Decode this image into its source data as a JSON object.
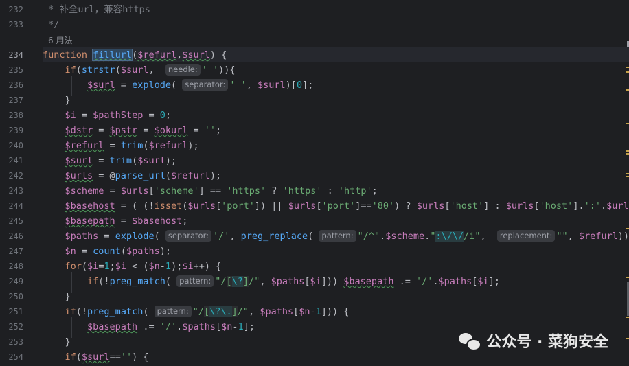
{
  "usage_hint": "6 用法",
  "line_numbers": [
    "232",
    "233",
    "234",
    "235",
    "236",
    "237",
    "238",
    "239",
    "240",
    "241",
    "242",
    "243",
    "244",
    "245",
    "246",
    "247",
    "248",
    "249",
    "250",
    "251",
    "252",
    "253",
    "254"
  ],
  "current_line": "234",
  "lines": {
    "l232": " * 补全url，兼容https",
    "l233": " */",
    "l234": {
      "kw": "function ",
      "name": "fillurl",
      "p1": "(",
      "a1": "$refurl",
      "c": ",",
      "a2": "$surl",
      "p2": ") {"
    },
    "hints": {
      "needle": "needle:",
      "separator": "separator:",
      "pattern": "pattern:",
      "replacement": "replacement:"
    }
  },
  "watermark": {
    "text": "公众号 · 菜狗安全",
    "icon": "wechat-icon"
  },
  "marker_colors": {
    "warning": "#c6a24a",
    "scroll": "#9da0a8"
  }
}
